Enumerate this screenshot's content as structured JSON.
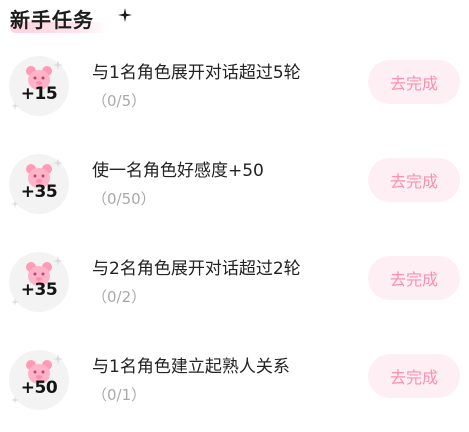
{
  "section": {
    "title": "新手任务"
  },
  "colors": {
    "accent_pink": "#ff8fae",
    "button_bg": "#fdeff3",
    "badge_bg": "#f3f3f4",
    "progress_text": "#a9a9ab",
    "bear": "#ff9ab7"
  },
  "icons": {
    "badge": "pink-bear-icon",
    "decoration": "sparkle-icon"
  },
  "tasks": [
    {
      "points": "+15",
      "title": "与1名角色展开对话超过5轮",
      "progress": "（0/5）",
      "button": "去完成"
    },
    {
      "points": "+35",
      "title": "使一名角色好感度+50",
      "progress": "（0/50）",
      "button": "去完成"
    },
    {
      "points": "+35",
      "title": "与2名角色展开对话超过2轮",
      "progress": "（0/2）",
      "button": "去完成"
    },
    {
      "points": "+50",
      "title": "与1名角色建立起熟人关系",
      "progress": "（0/1）",
      "button": "去完成"
    }
  ]
}
